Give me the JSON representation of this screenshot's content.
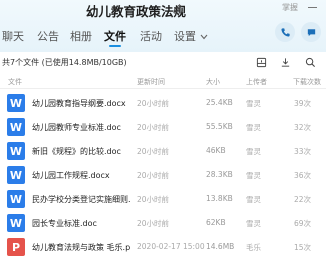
{
  "header": {
    "title": "幼儿教育政策法规",
    "owner_tag": "掌握"
  },
  "tabs": [
    {
      "label": "聊天"
    },
    {
      "label": "公告"
    },
    {
      "label": "相册"
    },
    {
      "label": "文件"
    },
    {
      "label": "活动"
    },
    {
      "label": "设置"
    }
  ],
  "active_tab": "文件",
  "toolbar": {
    "summary": "共7个文件 (已使用14.8MB/10GB)"
  },
  "columns": {
    "name": "文件",
    "time": "更新时间",
    "size": "大小",
    "uploader": "上传者",
    "downloads": "下载次数"
  },
  "files": [
    {
      "icon": "W",
      "name": "幼儿园教育指导纲要.docx",
      "time": "20小时前",
      "size": "25.4KB",
      "uploader": "雪灵",
      "downloads": "39次"
    },
    {
      "icon": "W",
      "name": "幼儿园教师专业标准.doc",
      "time": "20小时前",
      "size": "55.5KB",
      "uploader": "雪灵",
      "downloads": "32次"
    },
    {
      "icon": "W",
      "name": "新旧《规程》的比较.doc",
      "time": "20小时前",
      "size": "46KB",
      "uploader": "雪灵",
      "downloads": "33次"
    },
    {
      "icon": "W",
      "name": "幼儿园工作规程.docx",
      "time": "20小时前",
      "size": "28.3KB",
      "uploader": "雪灵",
      "downloads": "36次"
    },
    {
      "icon": "W",
      "name": "民办学校分类登记实施细则.d...",
      "time": "20小时前",
      "size": "13.8KB",
      "uploader": "雪灵",
      "downloads": "22次"
    },
    {
      "icon": "W",
      "name": "园长专业标准.doc",
      "time": "20小时前",
      "size": "62KB",
      "uploader": "雪灵",
      "downloads": "69次"
    },
    {
      "icon": "P",
      "name": "幼儿教育法规与政策 毛乐.ppt",
      "time": "2020-02-17 15:00",
      "size": "14.6MB",
      "uploader": "毛乐",
      "downloads": "15次"
    }
  ],
  "colors": {
    "accent": "#1c8fe0",
    "word_icon": "#2b7de9",
    "ppt_icon": "#e5534b"
  }
}
